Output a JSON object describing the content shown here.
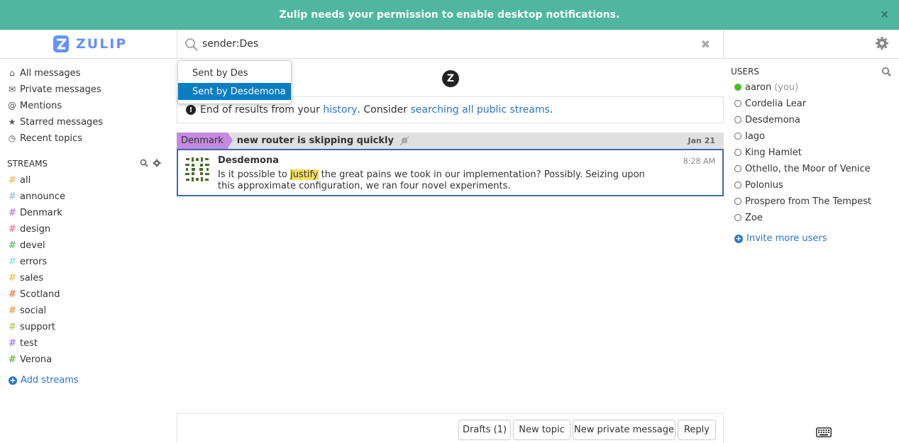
{
  "banner": {
    "text": "Zulip needs your permission to",
    "link": "enable desktop notifications.",
    "close": "×"
  },
  "brand": {
    "name": "ZULIP"
  },
  "search": {
    "value": "sender:Des",
    "clear": "✖"
  },
  "dropdown": {
    "items": [
      "Sent by Des",
      "Sent by Desdemona"
    ]
  },
  "nav": {
    "items": [
      {
        "label": "All messages",
        "icon": "home-icon"
      },
      {
        "label": "Private messages",
        "icon": "envelope-icon"
      },
      {
        "label": "Mentions",
        "icon": "at-icon"
      },
      {
        "label": "Starred messages",
        "icon": "star-icon"
      },
      {
        "label": "Recent topics",
        "icon": "clock-icon"
      }
    ]
  },
  "streams": {
    "title": "STREAMS",
    "items": [
      {
        "name": "all",
        "color": "#f5c266"
      },
      {
        "name": "announce",
        "color": "#a2c3f0"
      },
      {
        "name": "Denmark",
        "color": "#c489e0"
      },
      {
        "name": "design",
        "color": "#e3869b"
      },
      {
        "name": "devel",
        "color": "#6dc27a"
      },
      {
        "name": "errors",
        "color": "#9fe0ee"
      },
      {
        "name": "sales",
        "color": "#f5c266"
      },
      {
        "name": "Scotland",
        "color": "#f2804b"
      },
      {
        "name": "social",
        "color": "#f0a34a"
      },
      {
        "name": "support",
        "color": "#b5d262"
      },
      {
        "name": "test",
        "color": "#a78bea"
      },
      {
        "name": "Verona",
        "color": "#6fba52"
      }
    ],
    "add": "Add streams"
  },
  "notice": {
    "prefix": "End of results from your",
    "link1": "history",
    "middle": ". Consider",
    "link2": "searching all public streams",
    "suffix": "."
  },
  "recipient": {
    "stream": "Denmark",
    "topic": "new router is skipping quickly",
    "date": "Jan 21"
  },
  "message": {
    "sender": "Desdemona",
    "time": "8:28 AM",
    "before": "Is it possible to ",
    "highlight": "justify",
    "after": " the great pains we took in our implementation? Possibly. Seizing upon this approximate configuration, we ran four novel experiments."
  },
  "compose": {
    "drafts": "Drafts (1)",
    "new_topic": "New topic",
    "new_pm": "New private message",
    "reply": "Reply"
  },
  "users": {
    "title": "USERS",
    "items": [
      {
        "name": "aaron",
        "suffix": "(you)",
        "online": true
      },
      {
        "name": "Cordelia Lear",
        "online": false
      },
      {
        "name": "Desdemona",
        "online": false
      },
      {
        "name": "Iago",
        "online": false
      },
      {
        "name": "King Hamlet",
        "online": false
      },
      {
        "name": "Othello, the Moor of Venice",
        "online": false
      },
      {
        "name": "Polonius",
        "online": false
      },
      {
        "name": "Prospero from The Tempest",
        "online": false
      },
      {
        "name": "Zoe",
        "online": false
      }
    ],
    "invite": "Invite more users"
  }
}
